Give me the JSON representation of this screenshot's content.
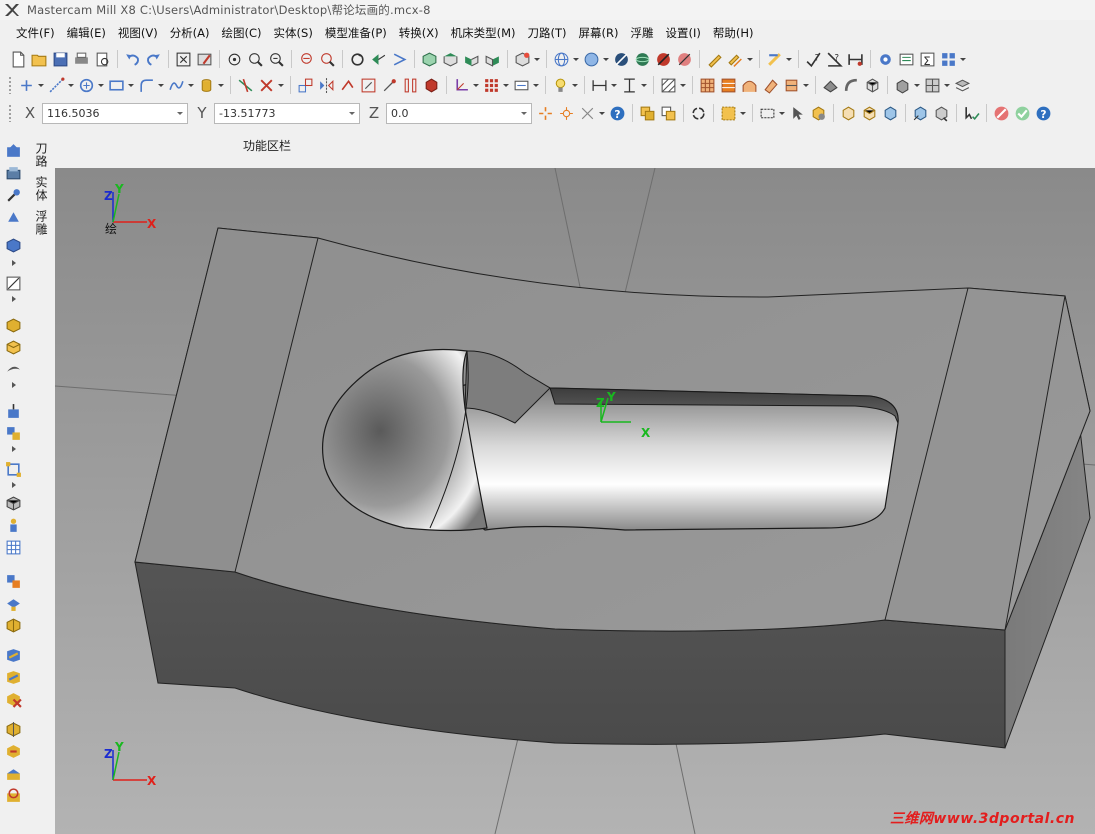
{
  "window": {
    "title": "Mastercam Mill X8  C:\\Users\\Administrator\\Desktop\\帮论坛画的.mcx-8"
  },
  "menu": [
    {
      "label": "文件(F)"
    },
    {
      "label": "编辑(E)"
    },
    {
      "label": "视图(V)"
    },
    {
      "label": "分析(A)"
    },
    {
      "label": "绘图(C)"
    },
    {
      "label": "实体(S)"
    },
    {
      "label": "模型准备(P)"
    },
    {
      "label": "转换(X)"
    },
    {
      "label": "机床类型(M)"
    },
    {
      "label": "刀路(T)"
    },
    {
      "label": "屏幕(R)"
    },
    {
      "label": "浮雕"
    },
    {
      "label": "设置(I)"
    },
    {
      "label": "帮助(H)"
    }
  ],
  "coords": {
    "x_label": "X",
    "x_value": "116.5036",
    "y_label": "Y",
    "y_value": "-13.51773",
    "z_label": "Z",
    "z_value": "0.0"
  },
  "function_area": {
    "label": "功能区栏"
  },
  "manager_tabs": [
    {
      "label": "刀路"
    },
    {
      "label": "实体"
    },
    {
      "label": "浮雕"
    }
  ],
  "viewport": {
    "top_gnomon": {
      "x": "X",
      "y": "Y",
      "z": "Z",
      "view": "绘"
    },
    "part_gnomon": {
      "x": "X",
      "y": "Y",
      "z": "Z"
    },
    "bottom_gnomon": {
      "x": "X",
      "y": "Y",
      "z": "Z"
    },
    "watermark": "三维网www.3dportal.cn"
  },
  "colors": {
    "background_top": "#8a8a8a",
    "background_bottom": "#b3b3b3",
    "axis_x": "#e0201a",
    "axis_y": "#19b81f",
    "axis_z": "#1a2bd0",
    "watermark": "#e31d1d"
  }
}
